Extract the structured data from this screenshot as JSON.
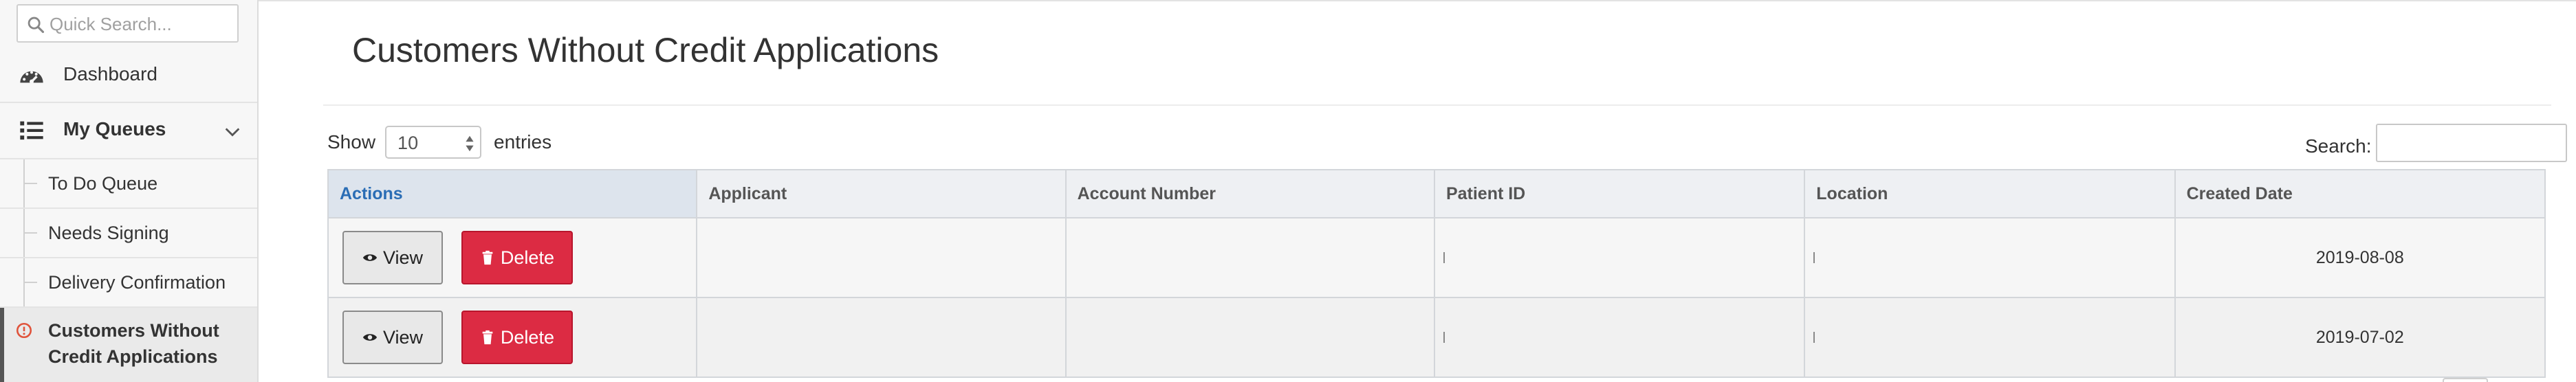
{
  "sidebar": {
    "search_placeholder": "Quick Search...",
    "dashboard_label": "Dashboard",
    "queues_label": "My Queues",
    "sub_items": [
      "To Do Queue",
      "Needs Signing",
      "Delivery Confirmation"
    ],
    "active_item": "Customers Without Credit Applications"
  },
  "main": {
    "title": "Customers Without Credit Applications",
    "show_label": "Show",
    "entries_value": "10",
    "entries_label": "entries",
    "search_label": "Search:",
    "columns": [
      "Actions",
      "Applicant",
      "Account Number",
      "Patient ID",
      "Location",
      "Created Date"
    ],
    "rows": [
      {
        "view_label": "View",
        "delete_label": "Delete",
        "applicant": "",
        "account_number": "",
        "created_date": "2019-08-08"
      },
      {
        "view_label": "View",
        "delete_label": "Delete",
        "applicant": "",
        "account_number": "",
        "created_date": "2019-07-02"
      }
    ]
  },
  "colors": {
    "accent": "#2a6db5",
    "delete": "#dc2b43",
    "alert": "#e0533b"
  },
  "icons": [
    "search-icon",
    "dashboard-icon",
    "list-icon",
    "chevron-down-icon",
    "alert-circle-icon",
    "eye-icon",
    "trash-icon"
  ]
}
